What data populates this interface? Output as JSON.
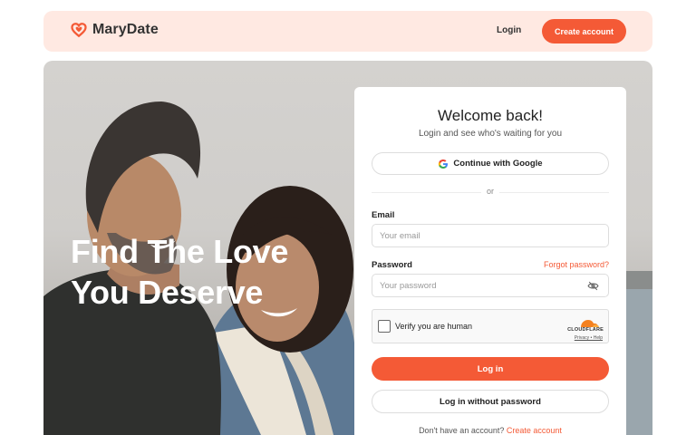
{
  "brand": {
    "name": "MaryDate",
    "accent": "#f45a36"
  },
  "nav": {
    "login_label": "Login",
    "create_label": "Create account"
  },
  "hero": {
    "title": "Find The Love You Deserve"
  },
  "card": {
    "title": "Welcome back!",
    "subtitle": "Login and see who's waiting for you",
    "google_label": "Continue with Google",
    "divider": "or",
    "email": {
      "label": "Email",
      "placeholder": "Your email"
    },
    "password": {
      "label": "Password",
      "placeholder": "Your password",
      "forgot": "Forgot password?"
    },
    "captcha": {
      "label": "Verify you are human",
      "provider": "CLOUDFLARE",
      "links": "Privacy • Help"
    },
    "login_button": "Log in",
    "nopass_button": "Log in without password",
    "footer_prefix": "Don't have an account?",
    "footer_link": "Create account"
  },
  "icons": [
    "heart-logo-icon",
    "google-icon",
    "eye-off-icon",
    "cloudflare-icon"
  ]
}
